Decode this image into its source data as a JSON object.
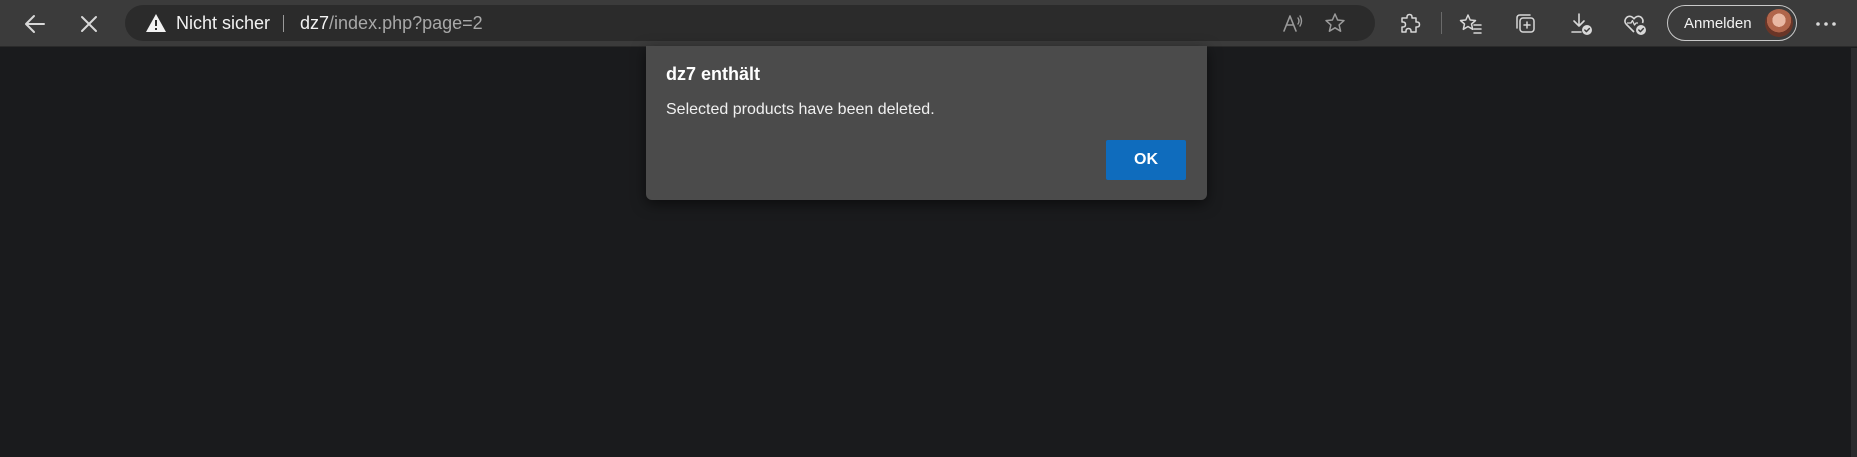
{
  "browser": {
    "back_icon": "arrow-left-icon",
    "stop_icon": "close-icon",
    "security": {
      "icon": "warning-triangle-icon",
      "label": "Nicht sicher"
    },
    "url": {
      "host": "dz7",
      "path": "/index.php?page=2"
    },
    "address_icons": [
      "read-aloud-icon",
      "favorite-star-icon"
    ],
    "toolbar_icons": [
      "extensions-icon",
      "favorites-icon",
      "collections-icon",
      "downloads-icon",
      "browser-essentials-icon"
    ],
    "signin_label": "Anmelden",
    "more_icon": "more-horizontal-icon"
  },
  "dialog": {
    "title": "dz7 enthält",
    "message": "Selected products have been deleted.",
    "ok_label": "OK"
  },
  "colors": {
    "page_background": "#1a1b1d",
    "toolbar": "#3b3b3b",
    "dialog": "#4b4b4b",
    "accent": "#0f6cbd"
  }
}
